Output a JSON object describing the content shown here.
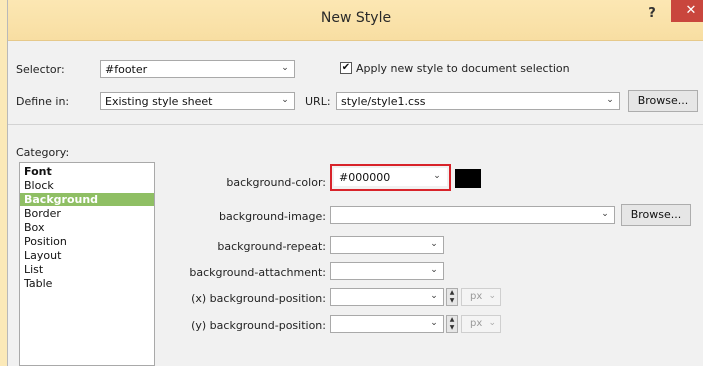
{
  "window": {
    "title": "New Style",
    "help": "?",
    "close": "✕"
  },
  "selector": {
    "label": "Selector:",
    "value": "#footer"
  },
  "apply": {
    "label": "Apply new style to document selection",
    "checked": true
  },
  "define_in": {
    "label": "Define in:",
    "value": "Existing style sheet"
  },
  "url": {
    "label": "URL:",
    "value": "style/style1.css",
    "browse": "Browse..."
  },
  "category": {
    "label": "Category:",
    "items": [
      "Font",
      "Block",
      "Background",
      "Border",
      "Box",
      "Position",
      "Layout",
      "List",
      "Table"
    ],
    "selected": "Background"
  },
  "properties": {
    "bg_color": {
      "label": "background-color:",
      "value": "#000000",
      "swatch": "#000000"
    },
    "bg_image": {
      "label": "background-image:",
      "value": "",
      "browse": "Browse..."
    },
    "bg_repeat": {
      "label": "background-repeat:",
      "value": ""
    },
    "bg_attachment": {
      "label": "background-attachment:",
      "value": ""
    },
    "bg_pos_x": {
      "label": "(x) background-position:",
      "value": "",
      "unit": "px"
    },
    "bg_pos_y": {
      "label": "(y) background-position:",
      "value": "",
      "unit": "px"
    }
  },
  "colors": {
    "titlebar": "#f8dea2",
    "close": "#c9463d",
    "selected": "#8fbf64",
    "highlight": "#d8232a"
  }
}
